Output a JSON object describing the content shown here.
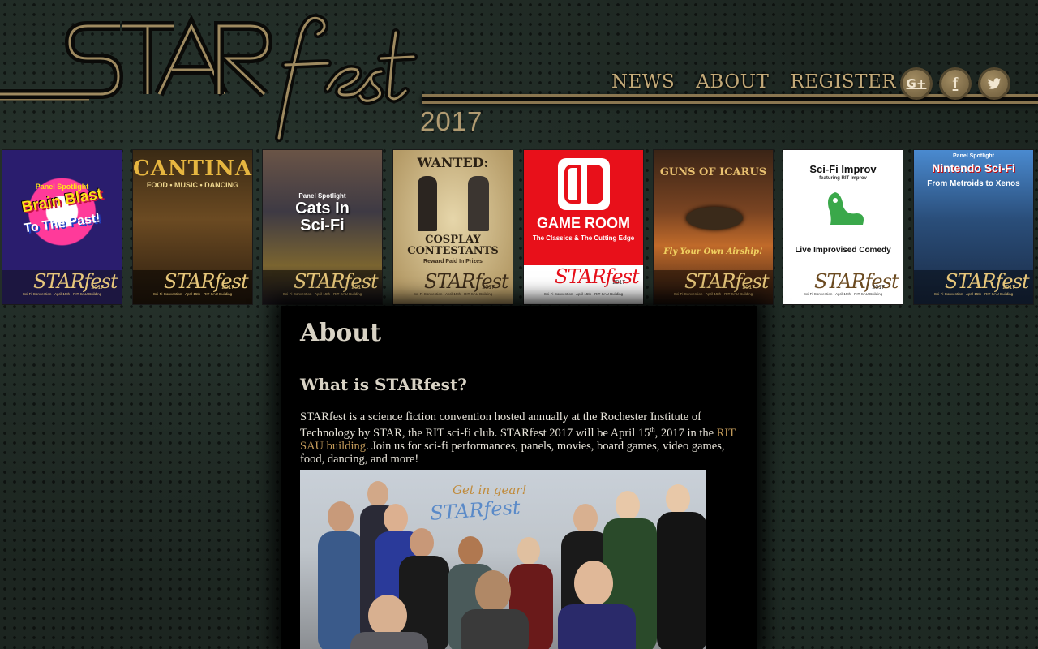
{
  "header": {
    "logo_text": "STARfest",
    "logo_year": "2017",
    "nav": [
      {
        "label": "NEWS"
      },
      {
        "label": "ABOUT"
      },
      {
        "label": "REGISTER"
      }
    ],
    "social": [
      {
        "icon": "google-plus-icon",
        "glyph": "G+"
      },
      {
        "icon": "facebook-icon",
        "glyph": "f"
      },
      {
        "icon": "twitter-icon",
        "glyph": "🐦"
      }
    ]
  },
  "posters": [
    {
      "name": "brain-blast",
      "kicker": "Panel Spotlight",
      "title": "Brain Blast",
      "subtitle": "To The Past!",
      "bg": "#2a1d6e",
      "fg": "#ffe11a",
      "footer_color": "#e6c67a"
    },
    {
      "name": "cantina",
      "title": "CANTINA",
      "subtitle": "FOOD • MUSIC • DANCING",
      "bg": "#4a3418",
      "fg": "#e6b640",
      "footer_color": "#e6c67a"
    },
    {
      "name": "cats-in-sci-fi",
      "kicker": "Panel Spotlight",
      "title": "Cats In Sci-Fi",
      "bg": "#2a2f3b",
      "fg": "#ffffff",
      "footer_color": "#e6c67a"
    },
    {
      "name": "cosplay-contestants",
      "title": "WANTED:",
      "subtitle": "COSPLAY CONTESTANTS",
      "tagline": "Reward Paid In Prizes",
      "bg": "#cdb88a",
      "fg": "#2b2114",
      "footer_color": "#3a2a18"
    },
    {
      "name": "game-room",
      "title": "GAME ROOM",
      "subtitle": "The Classics & The Cutting Edge",
      "bg": "#e8101a",
      "fg": "#ffffff",
      "footer_color": "#ffffff"
    },
    {
      "name": "guns-of-icarus",
      "title": "GUNS OF ICARUS",
      "subtitle": "Fly Your Own Airship!",
      "bg": "#5a3418",
      "fg": "#e8c070",
      "footer_color": "#e6c67a"
    },
    {
      "name": "sci-fi-improv",
      "title": "Sci-Fi Improv",
      "kicker": "featuring RIT Improv",
      "subtitle": "Live Improvised Comedy",
      "bg": "#ffffff",
      "fg": "#111111",
      "footer_color": "#6b4a20"
    },
    {
      "name": "nintendo-sci-fi",
      "kicker": "Panel Spotlight",
      "title": "Nintendo Sci-Fi",
      "subtitle": "From Metroids to Xenos",
      "bg": "#2a4e7a",
      "fg": "#ffffff",
      "footer_color": "#e6c67a"
    }
  ],
  "poster_footer": {
    "logo": "STARfest",
    "year": "2017",
    "line": "Sci-Fi Convention - April 15th - RIT SAU Building"
  },
  "content": {
    "heading": "About",
    "subheading": "What is STARfest?",
    "para_part1": "STARfest is a science fiction convention hosted annually at the Rochester Institute of Technology by STAR, the RIT sci-fi club.  STARfest 2017 will be April 15",
    "para_sup": "th",
    "para_part2": ", 2017 in the ",
    "para_link": "RIT SAU building",
    "para_part3": ".  Join us for sci-fi performances, panels, movies, board games, video games, food, dancing, and more!",
    "photo_caption": "Get in gear! STARfest 2017"
  },
  "colors": {
    "gold": "#c2a978",
    "link": "#c29a5a",
    "background": "#1c2520"
  }
}
